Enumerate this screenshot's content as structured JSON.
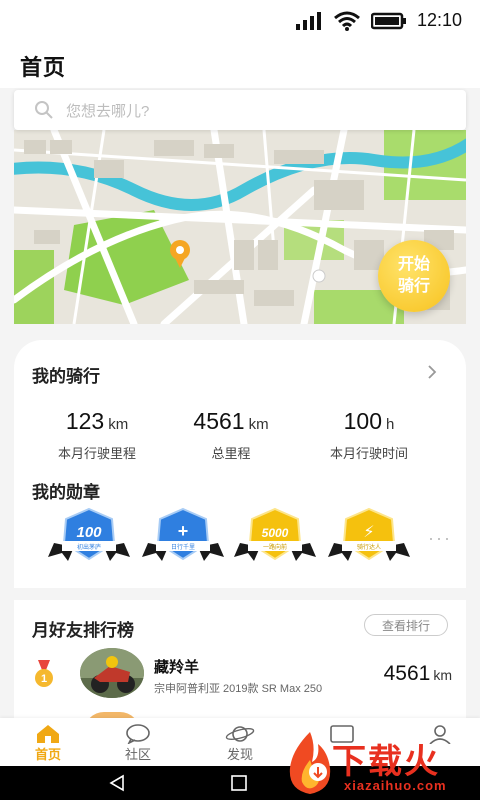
{
  "status_bar": {
    "time": "12:10"
  },
  "header": {
    "title": "首页"
  },
  "search": {
    "placeholder": "您想去哪儿?"
  },
  "map": {
    "start_button_label": "开始\n骑行"
  },
  "my_ride": {
    "title": "我的骑行",
    "stats": [
      {
        "value": "123",
        "unit": "km",
        "label": "本月行驶里程"
      },
      {
        "value": "4561",
        "unit": "km",
        "label": "总里程"
      },
      {
        "value": "100",
        "unit": "h",
        "label": "本月行驶时间"
      }
    ],
    "badges_title": "我的勋章",
    "badges": [
      {
        "text": "100",
        "ribbon": "初出茅庐",
        "color": "#2f7fe0",
        "icon": "badge-100-icon"
      },
      {
        "text": "+",
        "ribbon": "日行千里",
        "color": "#2f7fe0",
        "icon": "badge-plus-icon"
      },
      {
        "text": "5000",
        "ribbon": "一路向前",
        "color": "#f5c10e",
        "icon": "badge-5000-icon"
      },
      {
        "text": "⚡",
        "ribbon": "骑行达人",
        "color": "#f5c10e",
        "icon": "badge-lightning-icon"
      }
    ],
    "more": "···"
  },
  "ranking": {
    "title": "月好友排行榜",
    "view_button": "查看排行",
    "entries": [
      {
        "rank": "1",
        "name": "藏羚羊",
        "bike": "宗申阿普利亚 2019款 SR Max 250",
        "distance": "4561",
        "unit": "km"
      }
    ]
  },
  "tabs": [
    {
      "label": "首页",
      "icon": "home-icon",
      "active": true
    },
    {
      "label": "社区",
      "icon": "chat-icon",
      "active": false
    },
    {
      "label": "发现",
      "icon": "planet-icon",
      "active": false
    },
    {
      "label": "",
      "icon": "message-icon",
      "active": false
    },
    {
      "label": "",
      "icon": "profile-icon",
      "active": false
    }
  ],
  "watermark": {
    "title": "下载火",
    "url": "xiazaihuo.com"
  },
  "colors": {
    "accent": "#f0a814",
    "badge_blue": "#2f7fe0",
    "badge_gold": "#f5c10e",
    "watermark_red": "#e8301f"
  }
}
